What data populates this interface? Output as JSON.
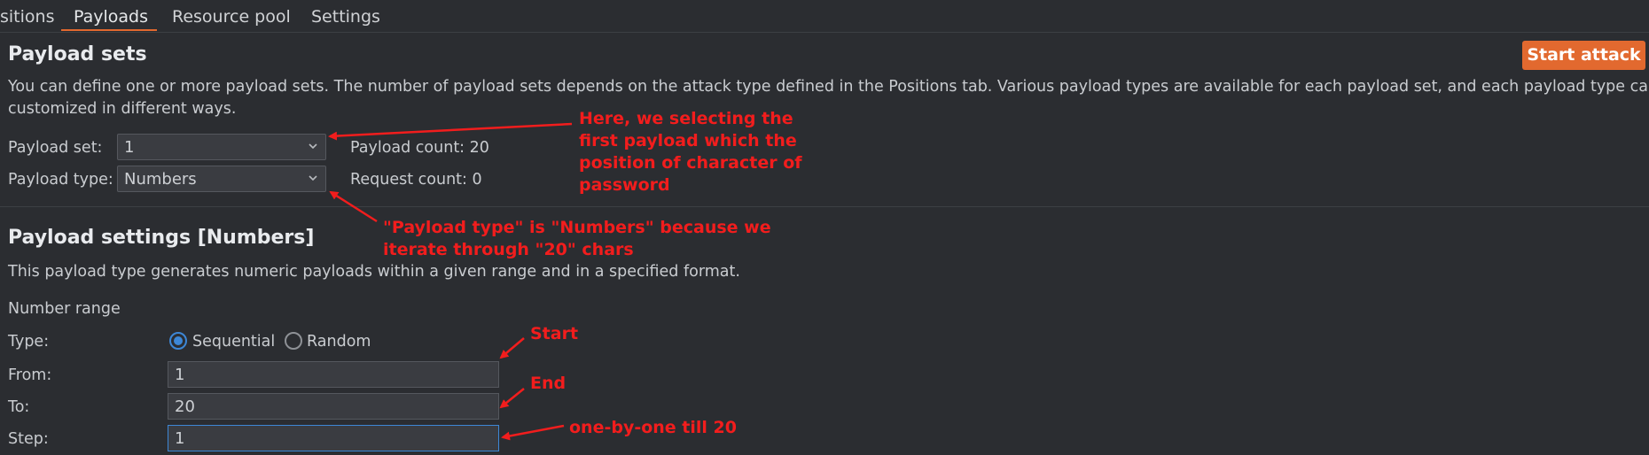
{
  "tabs": [
    {
      "label": "sitions",
      "active": false
    },
    {
      "label": "Payloads",
      "active": true
    },
    {
      "label": "Resource pool",
      "active": false
    },
    {
      "label": "Settings",
      "active": false
    }
  ],
  "payload_sets": {
    "title": "Payload sets",
    "start_attack_label": "Start attack",
    "description_line1": "You can define one or more payload sets. The number of payload sets depends on the attack type defined in the Positions tab. Various payload types are available for each payload set, and each payload type can be",
    "description_line2": "customized in different ways.",
    "payload_set_label": "Payload set:",
    "payload_set_value": "1",
    "payload_type_label": "Payload type:",
    "payload_type_value": "Numbers",
    "payload_count_text": "Payload count:  20",
    "request_count_text": "Request count: 0"
  },
  "payload_settings": {
    "title": "Payload settings [Numbers]",
    "description": "This payload type generates numeric payloads within a given range and in a specified format.",
    "number_range_label": "Number range",
    "type_label": "Type:",
    "sequential_label": "Sequential",
    "random_label": "Random",
    "selected_type": "Sequential",
    "from_label": "From:",
    "from_value": "1",
    "to_label": "To:",
    "to_value": "20",
    "step_label": "Step:",
    "step_value": "1"
  },
  "annotations": {
    "payload_set_note": [
      "Here, we selecting the",
      "first payload which the",
      "position of character of",
      "password"
    ],
    "payload_type_note": [
      "\"Payload type\" is \"Numbers\" because we",
      "iterate through \"20\" chars"
    ],
    "start_note": "Start",
    "end_note": "End",
    "step_note": "one-by-one till 20"
  },
  "colors": {
    "accent": "#e2692f",
    "annotation": "#f21d1d",
    "radio_selected": "#3d87d6",
    "background": "#2b2d31"
  }
}
